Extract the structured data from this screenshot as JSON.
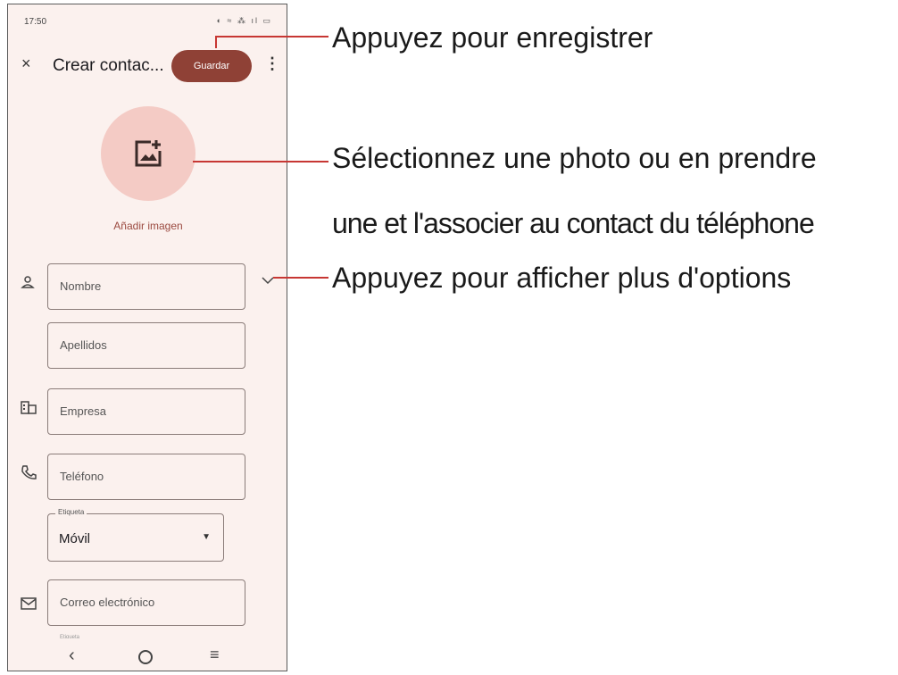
{
  "status_bar": {
    "time": "17:50",
    "icons": "◐ ≈ ⁂ ıl ▭"
  },
  "toolbar": {
    "close_glyph": "×",
    "title": "Crear contac...",
    "save_label": "Guardar",
    "menu_glyph": "⋮"
  },
  "photo": {
    "add_image_label": "Añadir imagen"
  },
  "form": {
    "first_name": "Nombre",
    "last_name": "Apellidos",
    "company": "Empresa",
    "phone": "Teléfono",
    "label_caption": "Etiqueta",
    "label_value": "Móvil",
    "email": "Correo electrónico",
    "partial_label": "Etiqueta"
  },
  "nav": {
    "back": "‹",
    "menu": "≡"
  },
  "callouts": {
    "save": "Appuyez pour enregistrer",
    "photo_line1": "Sélectionnez une photo ou en prendre",
    "photo_line2": "une et l'associer au contact du téléphone",
    "more_options": "Appuyez pour afficher plus d'options"
  },
  "colors": {
    "accent": "#8f4136",
    "leader": "#c73733",
    "avatar_bg": "#f4cbc5",
    "screen_bg": "#fbf1ee"
  }
}
